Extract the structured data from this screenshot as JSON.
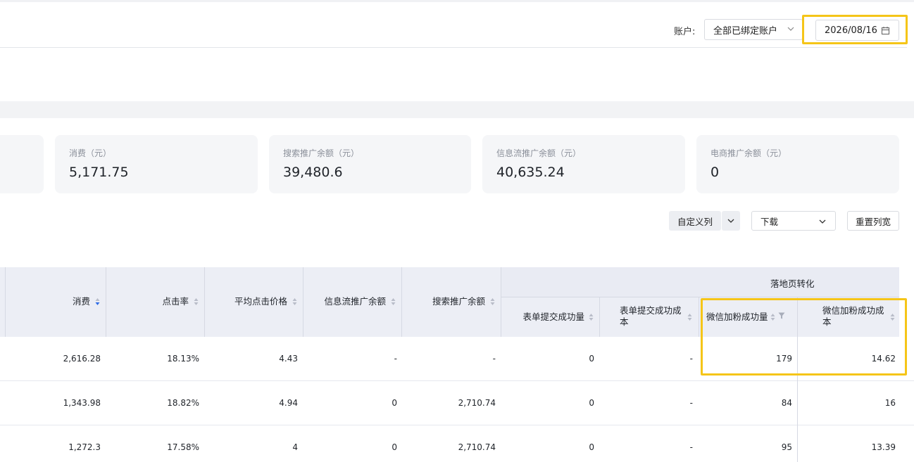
{
  "header": {
    "account_label": "账户:",
    "account_value": "全部已绑定账户",
    "date_value": "2026/08/16"
  },
  "icons": {
    "account": "chevron-down-icon",
    "date": "calendar-icon",
    "download": "chevron-down-icon",
    "custom": "chevron-down-icon"
  },
  "colors": {
    "highlight": "#f5c518",
    "sort_active": "#2e6be6"
  },
  "cards": [
    {
      "label": "消费（元）",
      "value": "5,171.75"
    },
    {
      "label": "搜索推广余额（元）",
      "value": "39,480.6"
    },
    {
      "label": "信息流推广余额（元）",
      "value": "40,635.24"
    },
    {
      "label": "电商推广余额（元）",
      "value": "0"
    }
  ],
  "toolbar": {
    "custom_columns": "自定义列",
    "download": "下载",
    "reset_width": "重置列宽"
  },
  "table": {
    "group_title": "落地页转化",
    "columns": [
      "消费",
      "点击率",
      "平均点击价格",
      "信息流推广余额",
      "搜索推广余额",
      "表单提交成功量",
      "表单提交成功成本",
      "微信加粉成功量",
      "微信加粉成功成本"
    ],
    "rows": [
      [
        "2,616.28",
        "18.13%",
        "4.43",
        "-",
        "-",
        "0",
        "-",
        "179",
        "14.62"
      ],
      [
        "1,343.98",
        "18.82%",
        "4.94",
        "0",
        "2,710.74",
        "0",
        "-",
        "84",
        "16"
      ],
      [
        "1,272.3",
        "17.58%",
        "4",
        "0",
        "2,710.74",
        "0",
        "-",
        "95",
        "13.39"
      ]
    ]
  }
}
